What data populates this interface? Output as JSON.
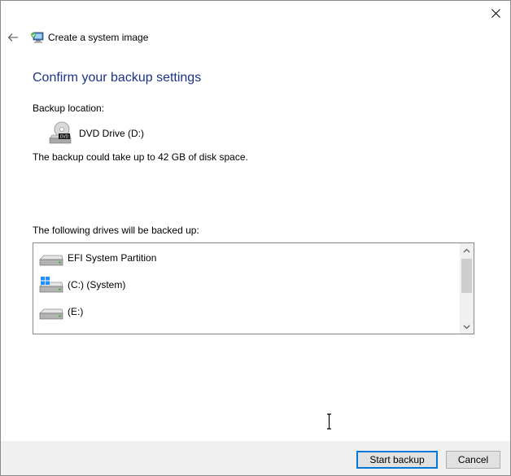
{
  "window": {
    "title": "Create a system image"
  },
  "heading": "Confirm your backup settings",
  "backup_location": {
    "label": "Backup location:",
    "drive": "DVD Drive (D:)",
    "drive_badge": "DVD",
    "size_note": "The backup could take up to 42 GB of disk space."
  },
  "drives": {
    "label": "The following drives will be backed up:",
    "items": [
      {
        "name": "EFI System Partition",
        "icon": "hard-drive-icon"
      },
      {
        "name": "(C:) (System)",
        "icon": "windows-drive-icon"
      },
      {
        "name": "(E:)",
        "icon": "hard-drive-icon"
      }
    ]
  },
  "footer": {
    "start_label": "Start backup",
    "cancel_label": "Cancel"
  },
  "colors": {
    "heading": "#1e3287",
    "primary_border": "#0078d7",
    "footer_bg": "#f0f0f0"
  }
}
